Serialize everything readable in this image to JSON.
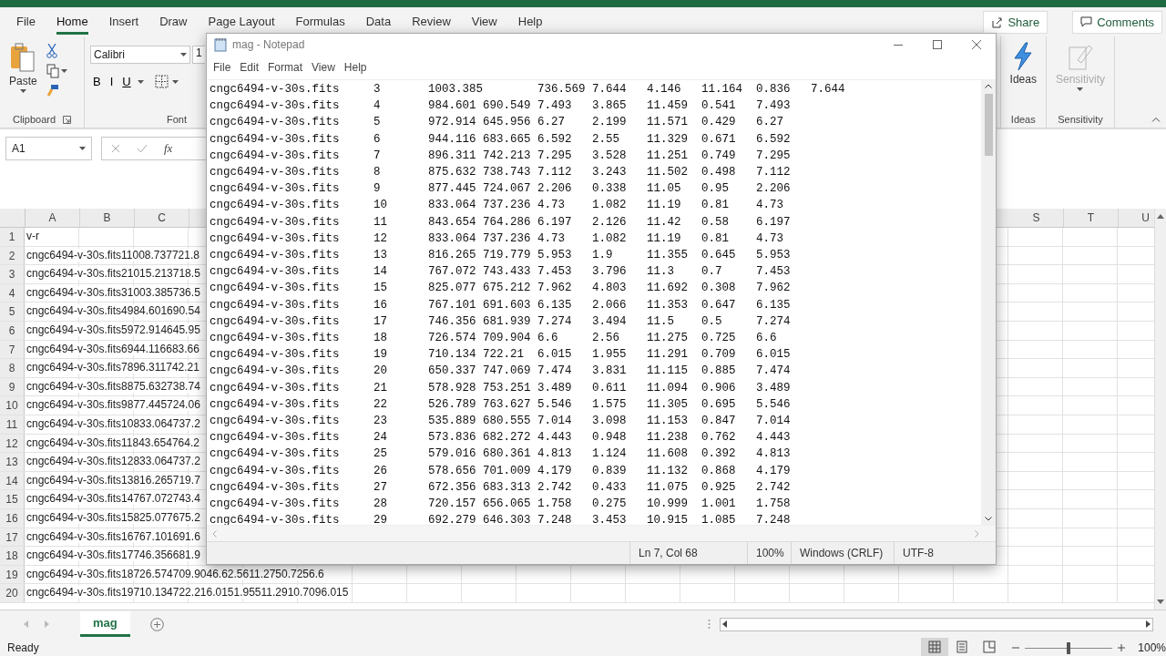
{
  "excel": {
    "ribbon_tabs": [
      {
        "label": "File",
        "selected": false
      },
      {
        "label": "Home",
        "selected": true
      },
      {
        "label": "Insert",
        "selected": false
      },
      {
        "label": "Draw",
        "selected": false
      },
      {
        "label": "Page Layout",
        "selected": false
      },
      {
        "label": "Formulas",
        "selected": false
      },
      {
        "label": "Data",
        "selected": false
      },
      {
        "label": "Review",
        "selected": false
      },
      {
        "label": "View",
        "selected": false
      },
      {
        "label": "Help",
        "selected": false
      }
    ],
    "share_button": "Share",
    "comments_button": "Comments",
    "clipboard_group": {
      "label": "Clipboard",
      "paste": "Paste"
    },
    "font_group": {
      "label": "Font",
      "font_name": "Calibri",
      "font_size": "1",
      "bold": "B",
      "italic": "I",
      "underline": "U"
    },
    "ideas_group": {
      "label": "Ideas",
      "button": "Ideas"
    },
    "sensitivity_group": {
      "label": "Sensitivity",
      "button": "Sensitivity",
      "disabled": true
    },
    "name_box": "A1",
    "function_label": "fx",
    "columns_left": [
      "A",
      "B",
      "C"
    ],
    "columns_right": [
      "S",
      "T",
      "U"
    ],
    "rows": [
      {
        "number": "1",
        "value": "v-r"
      },
      {
        "number": "2",
        "value": "cngc6494-v-30s.fits11008.737721.8"
      },
      {
        "number": "3",
        "value": "cngc6494-v-30s.fits21015.213718.5"
      },
      {
        "number": "4",
        "value": "cngc6494-v-30s.fits31003.385736.5"
      },
      {
        "number": "5",
        "value": "cngc6494-v-30s.fits4984.601690.54"
      },
      {
        "number": "6",
        "value": "cngc6494-v-30s.fits5972.914645.95"
      },
      {
        "number": "7",
        "value": "cngc6494-v-30s.fits6944.116683.66"
      },
      {
        "number": "8",
        "value": "cngc6494-v-30s.fits7896.311742.21"
      },
      {
        "number": "9",
        "value": "cngc6494-v-30s.fits8875.632738.74"
      },
      {
        "number": "10",
        "value": "cngc6494-v-30s.fits9877.445724.06"
      },
      {
        "number": "11",
        "value": "cngc6494-v-30s.fits10833.064737.2"
      },
      {
        "number": "12",
        "value": "cngc6494-v-30s.fits11843.654764.2"
      },
      {
        "number": "13",
        "value": "cngc6494-v-30s.fits12833.064737.2"
      },
      {
        "number": "14",
        "value": "cngc6494-v-30s.fits13816.265719.7"
      },
      {
        "number": "15",
        "value": "cngc6494-v-30s.fits14767.072743.4"
      },
      {
        "number": "16",
        "value": "cngc6494-v-30s.fits15825.077675.2"
      },
      {
        "number": "17",
        "value": "cngc6494-v-30s.fits16767.101691.6"
      },
      {
        "number": "18",
        "value": "cngc6494-v-30s.fits17746.356681.9"
      },
      {
        "number": "19",
        "value": "cngc6494-v-30s.fits18726.574709.9046.62.5611.2750.7256.6"
      },
      {
        "number": "20",
        "value": "cngc6494-v-30s.fits19710.134722.216.0151.95511.2910.7096.015"
      }
    ],
    "sheet_tabs": [
      {
        "label": "mag",
        "selected": true
      }
    ],
    "status": "Ready",
    "view_modes": [
      {
        "kind": "normal",
        "selected": true
      },
      {
        "kind": "page-layout",
        "selected": false
      },
      {
        "kind": "page-break",
        "selected": false
      }
    ],
    "zoom_slider": {
      "level": 0.5
    },
    "zoom": "100%"
  },
  "notepad": {
    "title": "mag - Notepad",
    "menu": [
      "File",
      "Edit",
      "Format",
      "View",
      "Help"
    ],
    "lines": [
      "cngc6494-v-30s.fits\t3\t1003.385\t736.569\t7.644\t4.146\t11.164\t0.836\t7.644",
      "cngc6494-v-30s.fits\t4\t984.601\t690.549\t7.493\t3.865\t11.459\t0.541\t7.493",
      "cngc6494-v-30s.fits\t5\t972.914\t645.956\t6.27\t2.199\t11.571\t0.429\t6.27",
      "cngc6494-v-30s.fits\t6\t944.116\t683.665\t6.592\t2.55\t11.329\t0.671\t6.592",
      "cngc6494-v-30s.fits\t7\t896.311\t742.213\t7.295\t3.528\t11.251\t0.749\t7.295",
      "cngc6494-v-30s.fits\t8\t875.632\t738.743\t7.112\t3.243\t11.502\t0.498\t7.112",
      "cngc6494-v-30s.fits\t9\t877.445\t724.067\t2.206\t0.338\t11.05\t0.95\t2.206",
      "cngc6494-v-30s.fits\t10\t833.064\t737.236\t4.73\t1.082\t11.19\t0.81\t4.73",
      "cngc6494-v-30s.fits\t11\t843.654\t764.286\t6.197\t2.126\t11.42\t0.58\t6.197",
      "cngc6494-v-30s.fits\t12\t833.064\t737.236\t4.73\t1.082\t11.19\t0.81\t4.73",
      "cngc6494-v-30s.fits\t13\t816.265\t719.779\t5.953\t1.9\t11.355\t0.645\t5.953",
      "cngc6494-v-30s.fits\t14\t767.072\t743.433\t7.453\t3.796\t11.3\t0.7\t7.453",
      "cngc6494-v-30s.fits\t15\t825.077\t675.212\t7.962\t4.803\t11.692\t0.308\t7.962",
      "cngc6494-v-30s.fits\t16\t767.101\t691.603\t6.135\t2.066\t11.353\t0.647\t6.135",
      "cngc6494-v-30s.fits\t17\t746.356\t681.939\t7.274\t3.494\t11.5\t0.5\t7.274",
      "cngc6494-v-30s.fits\t18\t726.574\t709.904\t6.6\t2.56\t11.275\t0.725\t6.6",
      "cngc6494-v-30s.fits\t19\t710.134\t722.21\t6.015\t1.955\t11.291\t0.709\t6.015",
      "cngc6494-v-30s.fits\t20\t650.337\t747.069\t7.474\t3.831\t11.115\t0.885\t7.474",
      "cngc6494-v-30s.fits\t21\t578.928\t753.251\t3.489\t0.611\t11.094\t0.906\t3.489",
      "cngc6494-v-30s.fits\t22\t526.789\t763.627\t5.546\t1.575\t11.305\t0.695\t5.546",
      "cngc6494-v-30s.fits\t23\t535.889\t680.555\t7.014\t3.098\t11.153\t0.847\t7.014",
      "cngc6494-v-30s.fits\t24\t573.836\t682.272\t4.443\t0.948\t11.238\t0.762\t4.443",
      "cngc6494-v-30s.fits\t25\t579.016\t680.361\t4.813\t1.124\t11.608\t0.392\t4.813",
      "cngc6494-v-30s.fits\t26\t578.656\t701.009\t4.179\t0.839\t11.132\t0.868\t4.179",
      "cngc6494-v-30s.fits\t27\t672.356\t683.313\t2.742\t0.433\t11.075\t0.925\t2.742",
      "cngc6494-v-30s.fits\t28\t720.157\t656.065\t1.758\t0.275\t10.999\t1.001\t1.758",
      "cngc6494-v-30s.fits\t29\t692.279\t646.303\t7.248\t3.453\t10.915\t1.085\t7.248"
    ],
    "status": {
      "position": "Ln 7, Col 68",
      "zoom": "100%",
      "line_ending": "Windows (CRLF)",
      "encoding": "UTF-8"
    }
  }
}
